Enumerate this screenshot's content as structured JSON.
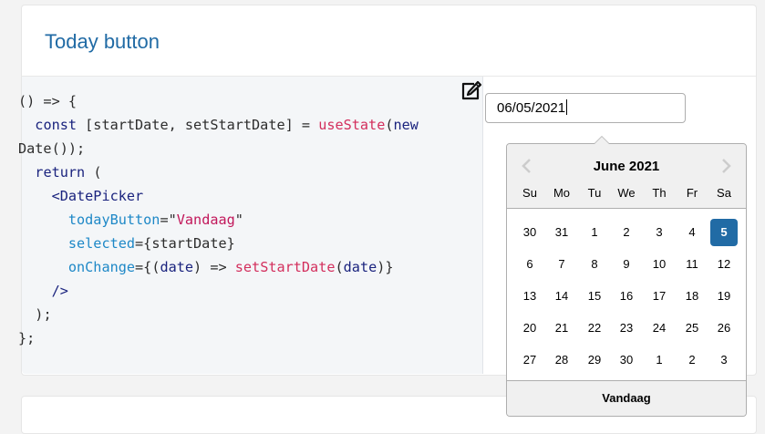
{
  "card": {
    "title": "Today button"
  },
  "code": {
    "line1_a": "() => {",
    "line2_kw": "const",
    "line2_b": " [startDate, setStartDate] = ",
    "line2_fn": "useState",
    "line2_c": "(",
    "line2_new": "new",
    "line3": "Date());",
    "line4_kw": "return",
    "line4_b": " (",
    "line5_tag": "<DatePicker",
    "line6_attr": "todayButton",
    "line6_eq": "=\"",
    "line6_str": "Vandaag",
    "line6_end": "\"",
    "line7_attr": "selected",
    "line7_b": "={startDate}",
    "line8_attr": "onChange",
    "line8_b": "={(",
    "line8_kw": "date",
    "line8_c": ") => ",
    "line8_fn": "setStartDate",
    "line8_d": "(",
    "line8_kw2": "date",
    "line8_e": ")}",
    "line9": "/>",
    "line10": ");",
    "line11": "};"
  },
  "input": {
    "value": "06/05/2021"
  },
  "datepicker": {
    "month_label": "June 2021",
    "weekdays": [
      "Su",
      "Mo",
      "Tu",
      "We",
      "Th",
      "Fr",
      "Sa"
    ],
    "weeks": [
      [
        "30",
        "31",
        "1",
        "2",
        "3",
        "4",
        "5"
      ],
      [
        "6",
        "7",
        "8",
        "9",
        "10",
        "11",
        "12"
      ],
      [
        "13",
        "14",
        "15",
        "16",
        "17",
        "18",
        "19"
      ],
      [
        "20",
        "21",
        "22",
        "23",
        "24",
        "25",
        "26"
      ],
      [
        "27",
        "28",
        "29",
        "30",
        "1",
        "2",
        "3"
      ]
    ],
    "selected_day": "5",
    "today_button": "Vandaag",
    "accent_color": "#216ba5"
  },
  "icons": {
    "edit": "edit-icon",
    "prev": "chevron-left-icon",
    "next": "chevron-right-icon"
  }
}
